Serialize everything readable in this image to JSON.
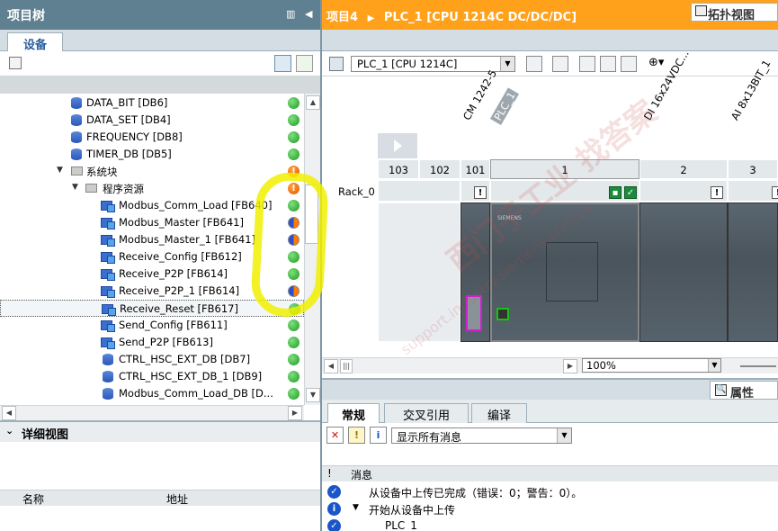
{
  "left_panel": {
    "title": "项目树",
    "tab_devices": "设备",
    "tree_items": [
      {
        "label": "DATA_BIT [DB6]",
        "icon": "db-icon",
        "status": "ok"
      },
      {
        "label": "DATA_SET [DB4]",
        "icon": "db-icon",
        "status": "ok"
      },
      {
        "label": "FREQUENCY [DB8]",
        "icon": "db-icon",
        "status": "ok"
      },
      {
        "label": "TIMER_DB [DB5]",
        "icon": "db-icon",
        "status": "ok"
      },
      {
        "label": "系统块",
        "icon": "folder-icon",
        "status": "warning"
      },
      {
        "label": "程序资源",
        "icon": "folder-icon",
        "status": "warning"
      },
      {
        "label": "Modbus_Comm_Load [FB640]",
        "icon": "fb-icon",
        "status": "ok"
      },
      {
        "label": "Modbus_Master [FB641]",
        "icon": "fb-icon",
        "status": "inconsistent"
      },
      {
        "label": "Modbus_Master_1 [FB641]",
        "icon": "fb-icon",
        "status": "inconsistent"
      },
      {
        "label": "Receive_Config [FB612]",
        "icon": "fb-icon",
        "status": "ok"
      },
      {
        "label": "Receive_P2P [FB614]",
        "icon": "fb-icon",
        "status": "ok"
      },
      {
        "label": "Receive_P2P_1 [FB614]",
        "icon": "fb-icon",
        "status": "inconsistent"
      },
      {
        "label": "Receive_Reset [FB617]",
        "icon": "fb-icon",
        "status": "ok"
      },
      {
        "label": "Send_Config [FB611]",
        "icon": "fb-icon",
        "status": "ok"
      },
      {
        "label": "Send_P2P [FB613]",
        "icon": "fb-icon",
        "status": "ok"
      },
      {
        "label": "CTRL_HSC_EXT_DB [DB7]",
        "icon": "db-icon",
        "status": "ok"
      },
      {
        "label": "CTRL_HSC_EXT_DB_1 [DB9]",
        "icon": "db-icon",
        "status": "ok"
      },
      {
        "label": "Modbus_Comm_Load_DB [D...",
        "icon": "db-icon",
        "status": "ok"
      }
    ],
    "detail_view_title": "详细视图",
    "detail_columns": [
      "名称",
      "地址"
    ]
  },
  "right_panel": {
    "breadcrumb": [
      "项目4",
      "PLC_1 [CPU 1214C DC/DC/DC]"
    ],
    "topology_button": "拓扑视图",
    "device_select": "PLC_1 [CPU 1214C]",
    "module_labels": [
      "CM 1242-5",
      "PLC_1",
      "DI 16x24VDC...",
      "AI 8x13BIT_1"
    ],
    "slots": [
      "103",
      "102",
      "101",
      "1",
      "2",
      "3"
    ],
    "rack_label": "Rack_0",
    "zoom": "100%",
    "properties_button": "属性",
    "tabs": [
      "常规",
      "交叉引用",
      "编译"
    ],
    "filter_select": "显示所有消息",
    "msg_columns": [
      "!",
      "消息"
    ],
    "messages": [
      {
        "icon": "check-icon",
        "text": "从设备中上传已完成（错误：0；警告：0）。"
      },
      {
        "icon": "info-icon",
        "text": "开始从设备中上传"
      },
      {
        "icon": "check-icon",
        "text": "PLC_1"
      }
    ]
  },
  "watermark": [
    "西门子工业 找答案",
    "support.industry.siemens.com/cs"
  ],
  "colors": {
    "left_title_bg": "#5f8090",
    "right_title_bg": "#ffa11a",
    "status_ok": "#1f9a1f",
    "status_warning": "#e05a00",
    "highlight": "#f0f000"
  }
}
